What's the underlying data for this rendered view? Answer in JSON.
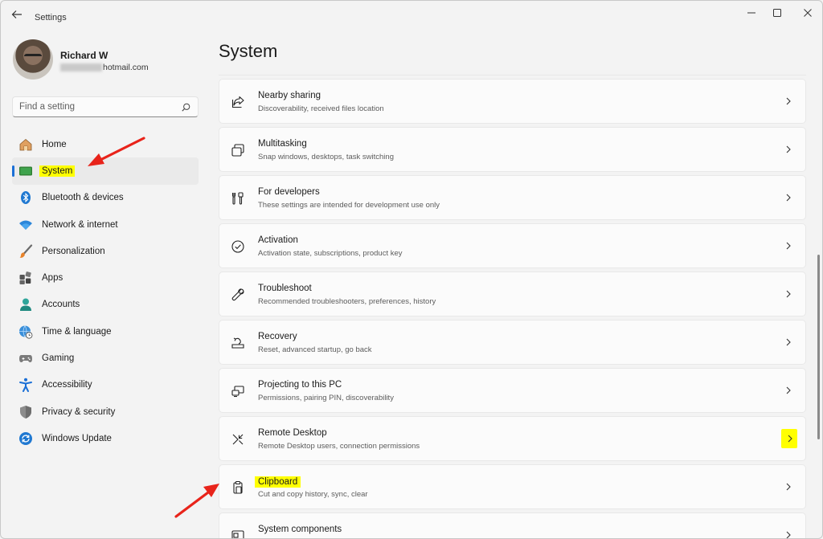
{
  "window": {
    "title": "Settings"
  },
  "profile": {
    "name": "Richard W",
    "email_visible": "hotmail.com"
  },
  "search": {
    "placeholder": "Find a setting"
  },
  "sidebar": {
    "items": [
      {
        "label": "Home",
        "icon": "home-icon",
        "selected": false
      },
      {
        "label": "System",
        "icon": "system-icon",
        "selected": true
      },
      {
        "label": "Bluetooth & devices",
        "icon": "bluetooth-icon",
        "selected": false
      },
      {
        "label": "Network & internet",
        "icon": "wifi-icon",
        "selected": false
      },
      {
        "label": "Personalization",
        "icon": "brush-icon",
        "selected": false
      },
      {
        "label": "Apps",
        "icon": "apps-icon",
        "selected": false
      },
      {
        "label": "Accounts",
        "icon": "accounts-icon",
        "selected": false
      },
      {
        "label": "Time & language",
        "icon": "globe-clock-icon",
        "selected": false
      },
      {
        "label": "Gaming",
        "icon": "gamepad-icon",
        "selected": false
      },
      {
        "label": "Accessibility",
        "icon": "accessibility-icon",
        "selected": false
      },
      {
        "label": "Privacy & security",
        "icon": "shield-icon",
        "selected": false
      },
      {
        "label": "Windows Update",
        "icon": "update-icon",
        "selected": false
      }
    ]
  },
  "main": {
    "title": "System",
    "settings": [
      {
        "title": "Nearby sharing",
        "subtitle": "Discoverability, received files location",
        "icon": "share-icon"
      },
      {
        "title": "Multitasking",
        "subtitle": "Snap windows, desktops, task switching",
        "icon": "multitasking-icon"
      },
      {
        "title": "For developers",
        "subtitle": "These settings are intended for development use only",
        "icon": "developer-tools-icon"
      },
      {
        "title": "Activation",
        "subtitle": "Activation state, subscriptions, product key",
        "icon": "check-circle-icon"
      },
      {
        "title": "Troubleshoot",
        "subtitle": "Recommended troubleshooters, preferences, history",
        "icon": "wrench-icon"
      },
      {
        "title": "Recovery",
        "subtitle": "Reset, advanced startup, go back",
        "icon": "recovery-icon"
      },
      {
        "title": "Projecting to this PC",
        "subtitle": "Permissions, pairing PIN, discoverability",
        "icon": "projecting-icon"
      },
      {
        "title": "Remote Desktop",
        "subtitle": "Remote Desktop users, connection permissions",
        "icon": "remote-desktop-icon"
      },
      {
        "title": "Clipboard",
        "subtitle": "Cut and copy history, sync, clear",
        "icon": "clipboard-icon"
      },
      {
        "title": "System components",
        "subtitle": "",
        "icon": "system-components-icon"
      }
    ]
  },
  "colors": {
    "accent": "#1a6fd6",
    "highlight": "#ffff00",
    "annotation_arrow": "#e8231a"
  }
}
